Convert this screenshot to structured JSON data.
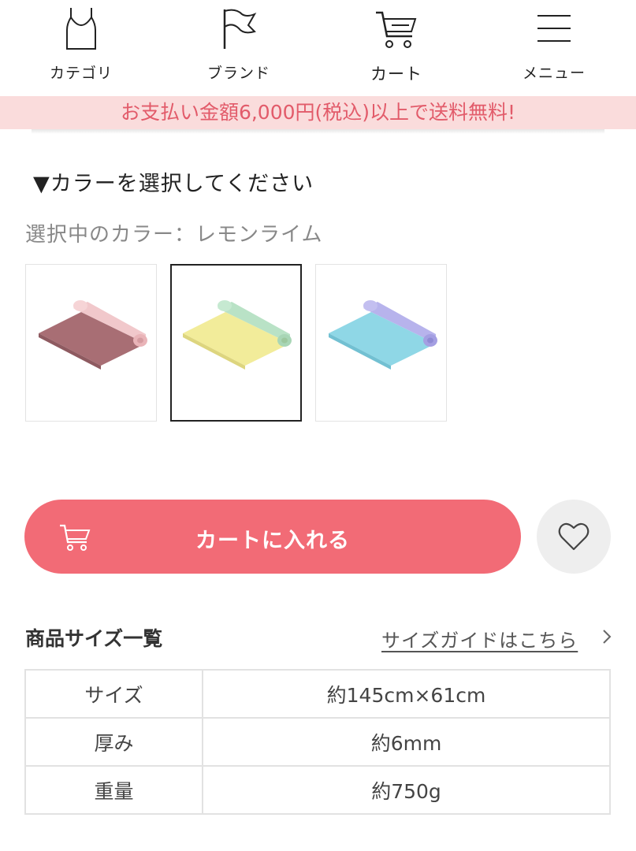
{
  "nav": {
    "items": [
      {
        "label": "カテゴリ",
        "icon": "tank-top-icon"
      },
      {
        "label": "ブランド",
        "icon": "flag-icon"
      },
      {
        "label": "カート",
        "icon": "cart-icon"
      },
      {
        "label": "メニュー",
        "icon": "hamburger-menu-icon"
      }
    ]
  },
  "banner": {
    "text": "お支払い金額6,000円(税込)以上で送料無料!",
    "bg_color": "#fadcdc",
    "text_color": "#e25b6a"
  },
  "color_select": {
    "heading": "▼カラーを選択してください",
    "selected_text": "選択中のカラー：レモンライム",
    "swatches": [
      {
        "icon": "yoga-mat-rose-icon",
        "selected": false
      },
      {
        "icon": "yoga-mat-lemon-lime-icon",
        "selected": true
      },
      {
        "icon": "yoga-mat-sky-icon",
        "selected": false
      }
    ]
  },
  "cart_button": {
    "label": "カートに入れる",
    "color": "#f26b76"
  },
  "favorite_button": {
    "icon": "heart-icon"
  },
  "size": {
    "title": "商品サイズ一覧",
    "guide_link": "サイズガイドはこちら",
    "rows": [
      {
        "key": "サイズ",
        "value": "約145cm×61cm"
      },
      {
        "key": "厚み",
        "value": "約6mm"
      },
      {
        "key": "重量",
        "value": "約750g"
      }
    ]
  }
}
